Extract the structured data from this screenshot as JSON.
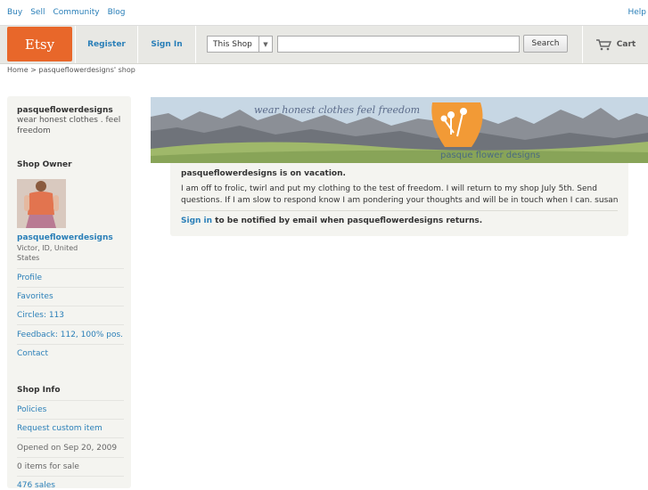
{
  "topnav": {
    "links": [
      "Buy",
      "Sell",
      "Community",
      "Blog"
    ],
    "help": "Help"
  },
  "header": {
    "logo": "Etsy",
    "register": "Register",
    "signin": "Sign In",
    "scope": "This Shop",
    "search_value": "",
    "search_button": "Search",
    "cart": "Cart"
  },
  "breadcrumb": "Home > pasqueflowerdesigns' shop",
  "sidebar": {
    "shop_name": "pasqueflowerdesigns",
    "tagline": "wear honest clothes . feel freedom",
    "owner_heading": "Shop Owner",
    "owner_name": "pasqueflowerdesigns",
    "location": "Victor, ID, United States",
    "owner_links": [
      "Profile",
      "Favorites",
      "Circles: 113",
      "Feedback: 112, 100% pos.",
      "Contact"
    ],
    "info_heading": "Shop Info",
    "info_links": [
      "Policies",
      "Request custom item"
    ],
    "opened": "Opened on Sep 20, 2009",
    "items": "0 items for sale",
    "sales": "476 sales"
  },
  "banner": {
    "script": "wear honest clothes feel freedom",
    "brand": "pasque flower designs"
  },
  "vacation": {
    "title": "pasqueflowerdesigns is on vacation.",
    "message": "I am off to frolic, twirl and put my clothing to the test of freedom. I will return to my shop July 5th. Send questions. If I am slow to respond know I am pondering your thoughts and will be in touch when I can. susan",
    "signin_link": "Sign in",
    "notify": " to be notified by email when pasqueflowerdesigns returns."
  },
  "colors": {
    "accent": "#e8672a",
    "link": "#2a7fb8"
  }
}
